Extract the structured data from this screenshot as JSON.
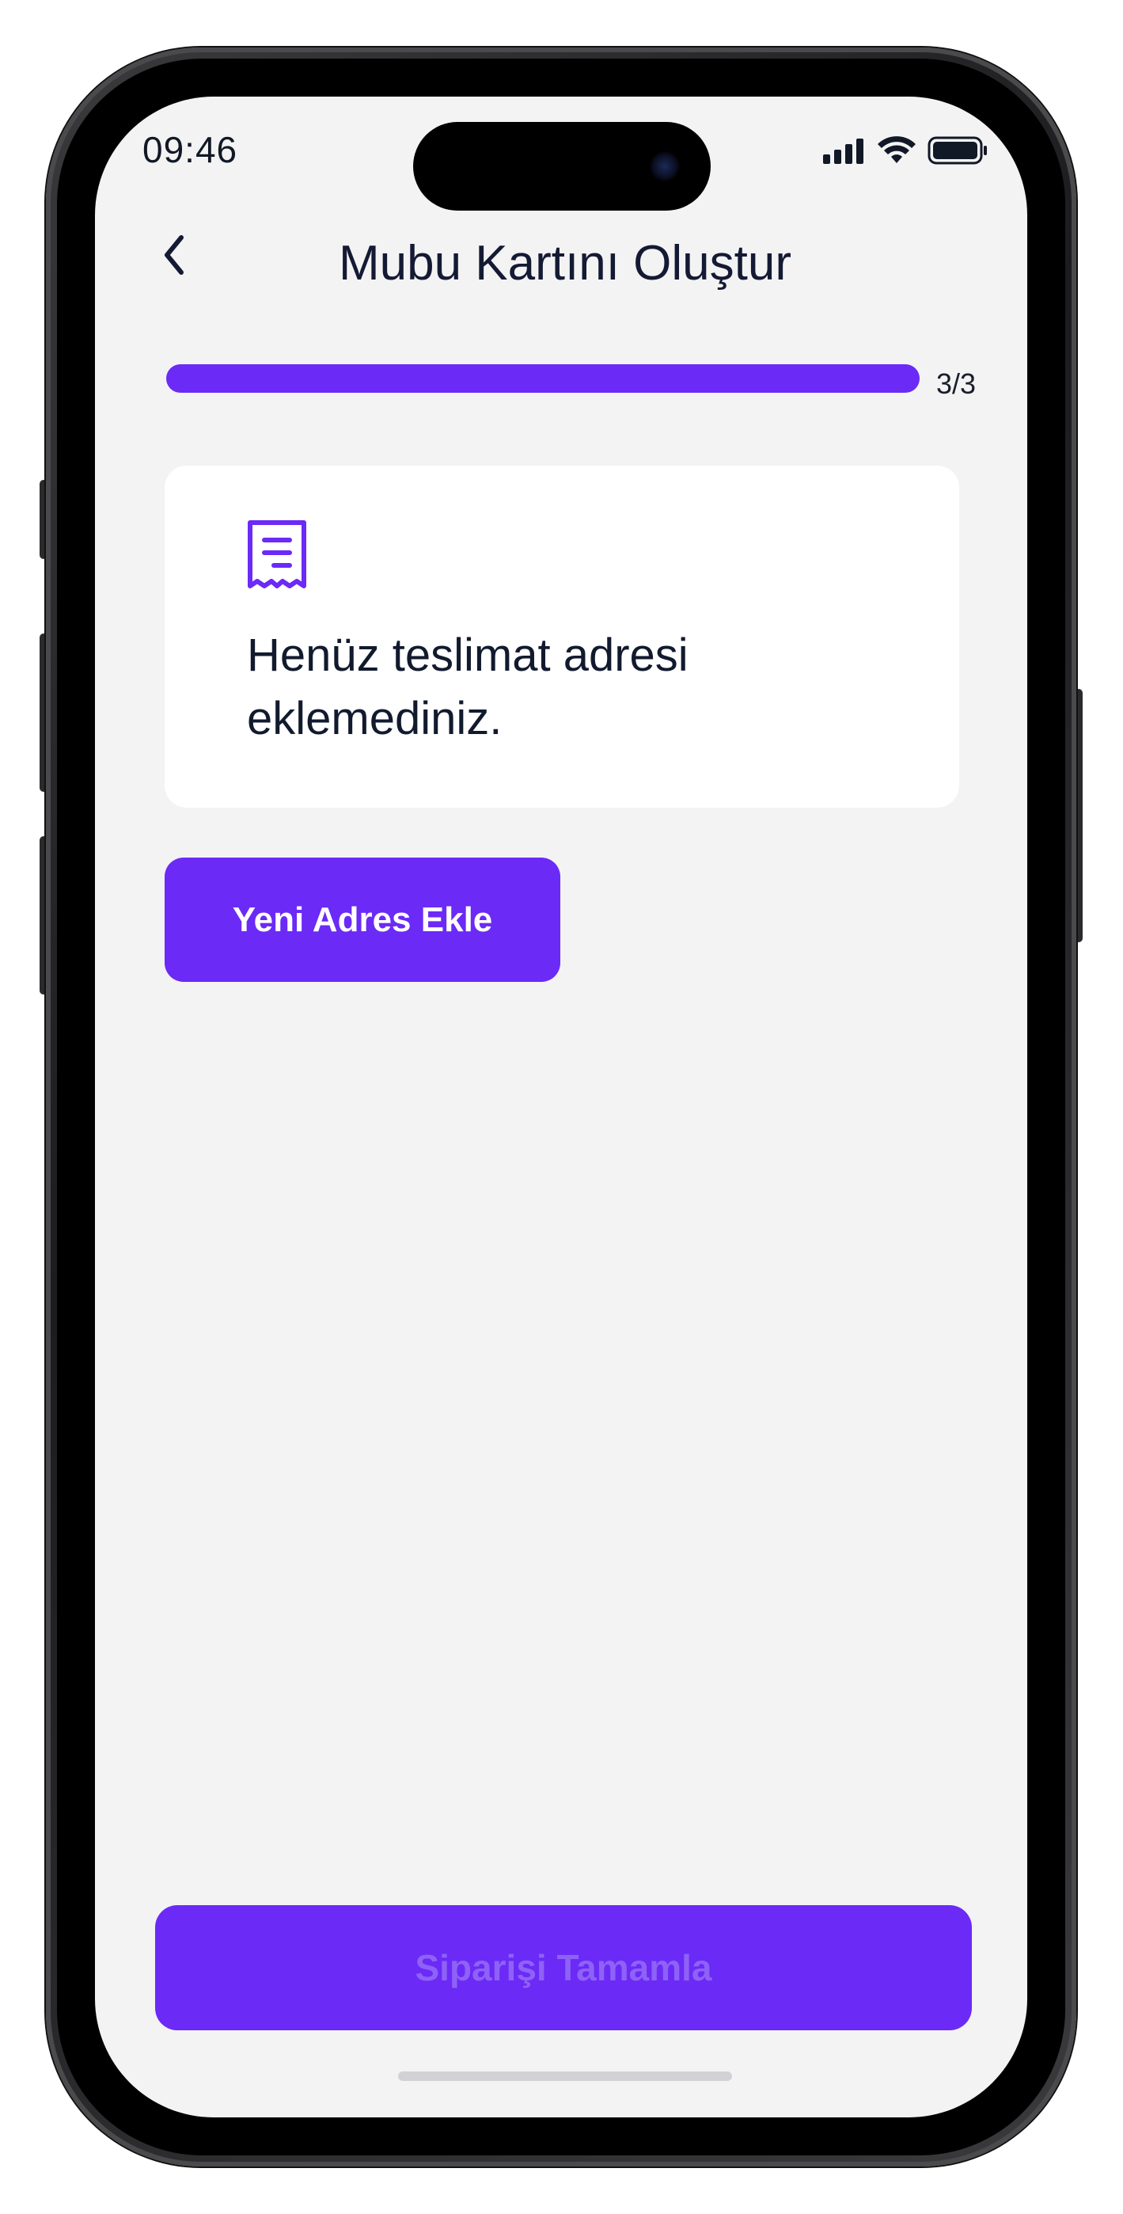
{
  "status_bar": {
    "time": "09:46",
    "icons": [
      "cellular-signal-icon",
      "wifi-icon",
      "battery-icon"
    ]
  },
  "header": {
    "back_icon": "chevron-left-icon",
    "title": "Mubu Kartını Oluştur"
  },
  "progress": {
    "label": "3/3",
    "current_step": 3,
    "total_steps": 3,
    "fill_fraction": 1.0
  },
  "empty_state": {
    "icon": "receipt-icon",
    "message": "Henüz teslimat adresi eklemediniz."
  },
  "add_address_button": {
    "label": "Yeni Adres Ekle"
  },
  "complete_order_button": {
    "label": "Siparişi Tamamla",
    "disabled": true
  },
  "colors": {
    "accent": "#6b2af6",
    "background": "#f3f3f4",
    "card": "#ffffff",
    "text_primary": "#121a2e",
    "disabled_text": "#8e62f6"
  }
}
